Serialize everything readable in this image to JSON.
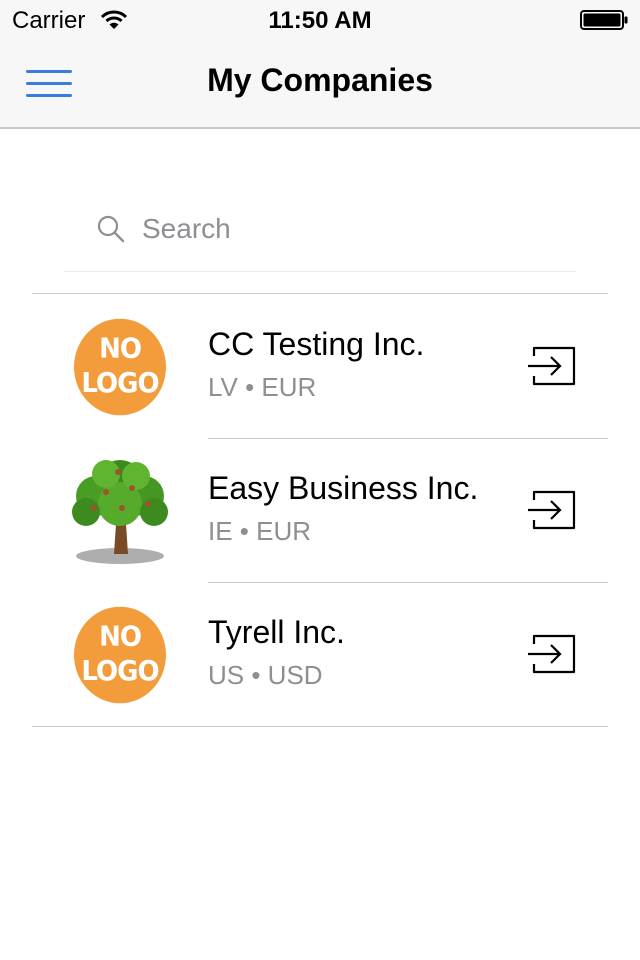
{
  "status_bar": {
    "carrier": "Carrier",
    "time": "11:50 AM"
  },
  "nav": {
    "title": "My Companies",
    "menu_icon": "hamburger-menu-icon",
    "accent_color": "#3a7de0"
  },
  "search": {
    "placeholder": "Search",
    "value": ""
  },
  "companies": [
    {
      "name": "CC Testing Inc.",
      "meta": "LV • EUR",
      "logo": "no-logo",
      "logo_line1": "NO",
      "logo_line2": "LOGO"
    },
    {
      "name": "Easy Business Inc.",
      "meta": "IE • EUR",
      "logo": "tree-logo"
    },
    {
      "name": "Tyrell Inc.",
      "meta": "US • USD",
      "logo": "no-logo",
      "logo_line1": "NO",
      "logo_line2": "LOGO"
    }
  ],
  "colors": {
    "no_logo_badge": "#f39c3c",
    "secondary_text": "#8e8e93",
    "separator": "#c8c7cc"
  }
}
